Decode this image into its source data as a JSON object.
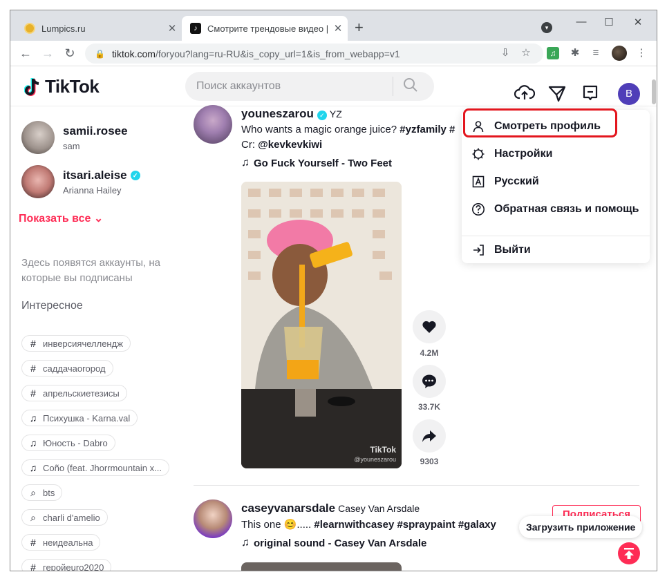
{
  "browser": {
    "tabs": [
      {
        "title": "Lumpics.ru",
        "active": false
      },
      {
        "title": "Смотрите трендовые видео | Tik",
        "active": true
      }
    ],
    "url_host": "tiktok.com",
    "url_path": "/foryou?lang=ru-RU&is_copy_url=1&is_from_webapp=v1"
  },
  "header": {
    "logo": "TikTok",
    "search_placeholder": "Поиск аккаунтов",
    "user_initial": "B"
  },
  "sidebar": {
    "accounts": [
      {
        "name": "samii.rosee",
        "sub": "sam",
        "verified": false
      },
      {
        "name": "itsari.aleise",
        "sub": "Arianna Hailey",
        "verified": true
      }
    ],
    "show_all": "Показать все",
    "hint": "Здесь появятся аккаунты, на которые вы подписаны",
    "section_title": "Интересное",
    "chips": [
      {
        "icon": "hashtag-icon",
        "label": "инверсиячеллендж"
      },
      {
        "icon": "hashtag-icon",
        "label": "саддачаогород"
      },
      {
        "icon": "hashtag-icon",
        "label": "апрельскиетезисы"
      },
      {
        "icon": "music-note-icon",
        "label": "Психушка - Karna.val"
      },
      {
        "icon": "music-note-icon",
        "label": "Юность - Dabro"
      },
      {
        "icon": "music-note-icon",
        "label": "Coño (feat. Jhorrmountain x..."
      },
      {
        "icon": "search-icon",
        "label": "bts"
      },
      {
        "icon": "search-icon",
        "label": "charli d'amelio"
      },
      {
        "icon": "hashtag-icon",
        "label": "неидеальна"
      },
      {
        "icon": "hashtag-icon",
        "label": "геройeuro2020"
      }
    ]
  },
  "feed": [
    {
      "username": "youneszarou",
      "nickname": "YZ",
      "verified": true,
      "caption_text": "Who wants a magic orange juice? ",
      "caption_tags": "#yzfamily #",
      "caption_line2_prefix": "Cr: ",
      "caption_mention": "@kevkevkiwi",
      "music": "Go Fuck Yourself - Two Feet",
      "watermark": "TikTok",
      "watermark_user": "@youneszarou",
      "likes": "4.2M",
      "comments": "33.7K",
      "shares": "9303"
    },
    {
      "username": "caseyvanarsdale",
      "nickname": "Casey Van Arsdale",
      "caption_text": "This one 😊..... ",
      "caption_tags": "#learnwithcasey #spraypaint #galaxy",
      "music": "original sound - Casey Van Arsdale",
      "subscribe_label": "Подписаться"
    }
  ],
  "get_app_label": "Загрузить приложение",
  "menu": {
    "items": [
      {
        "icon": "person-icon",
        "label": "Смотреть профиль"
      },
      {
        "icon": "settings-icon",
        "label": "Настройки"
      },
      {
        "icon": "language-icon",
        "label": "Русский"
      },
      {
        "icon": "help-icon",
        "label": "Обратная связь и помощь"
      },
      {
        "icon": "logout-icon",
        "label": "Выйти"
      }
    ]
  },
  "colors": {
    "accent": "#fe2c55",
    "highlight_box": "#e3161e",
    "verified": "#20d5ec"
  }
}
